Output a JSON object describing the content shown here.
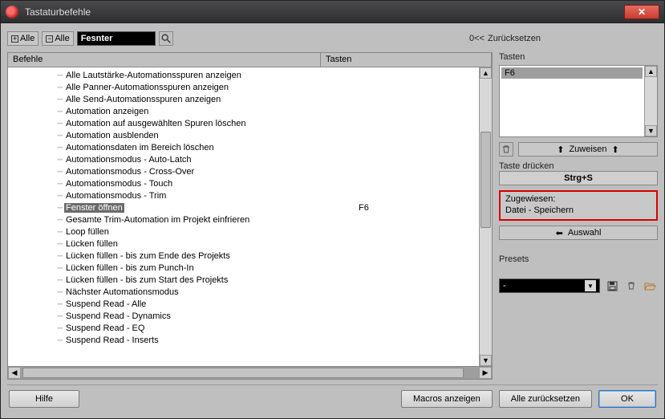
{
  "window": {
    "title": "Tastaturbefehle"
  },
  "toolbar": {
    "expand_all": "Alle",
    "collapse_all": "Alle",
    "search_value": "Fesnter",
    "reset_label": "Zurücksetzen",
    "reset_prefix": "0<<"
  },
  "columns": {
    "befehle": "Befehle",
    "tasten": "Tasten"
  },
  "commands": [
    {
      "label": "Alle Lautstärke-Automationsspuren anzeigen",
      "key": ""
    },
    {
      "label": "Alle Panner-Automationsspuren anzeigen",
      "key": ""
    },
    {
      "label": "Alle Send-Automationsspuren anzeigen",
      "key": ""
    },
    {
      "label": "Automation anzeigen",
      "key": ""
    },
    {
      "label": "Automation auf ausgewählten Spuren löschen",
      "key": ""
    },
    {
      "label": "Automation ausblenden",
      "key": ""
    },
    {
      "label": "Automationsdaten im Bereich löschen",
      "key": ""
    },
    {
      "label": "Automationsmodus - Auto-Latch",
      "key": ""
    },
    {
      "label": "Automationsmodus - Cross-Over",
      "key": ""
    },
    {
      "label": "Automationsmodus - Touch",
      "key": ""
    },
    {
      "label": "Automationsmodus - Trim",
      "key": ""
    },
    {
      "label": "Fenster öffnen",
      "key": "F6",
      "selected": true
    },
    {
      "label": "Gesamte Trim-Automation im Projekt einfrieren",
      "key": ""
    },
    {
      "label": "Loop füllen",
      "key": ""
    },
    {
      "label": "Lücken füllen",
      "key": ""
    },
    {
      "label": "Lücken füllen - bis zum Ende des Projekts",
      "key": ""
    },
    {
      "label": "Lücken füllen - bis zum Punch-In",
      "key": ""
    },
    {
      "label": "Lücken füllen - bis zum Start des Projekts",
      "key": ""
    },
    {
      "label": "Nächster Automationsmodus",
      "key": ""
    },
    {
      "label": "Suspend Read - Alle",
      "key": ""
    },
    {
      "label": "Suspend Read - Dynamics",
      "key": ""
    },
    {
      "label": "Suspend Read - EQ",
      "key": ""
    },
    {
      "label": "Suspend Read - Inserts",
      "key": ""
    }
  ],
  "right": {
    "tasten_label": "Tasten",
    "assigned_key": "F6",
    "assign_label": "Zuweisen",
    "press_label": "Taste drücken",
    "pressed_value": "Strg+S",
    "assigned_to_label": "Zugewiesen:",
    "assigned_to_value": "Datei - Speichern",
    "auswahl_label": "Auswahl",
    "presets_label": "Presets",
    "preset_value": "-"
  },
  "footer": {
    "help": "Hilfe",
    "macros": "Macros anzeigen",
    "reset_all": "Alle zurücksetzen",
    "ok": "OK"
  }
}
